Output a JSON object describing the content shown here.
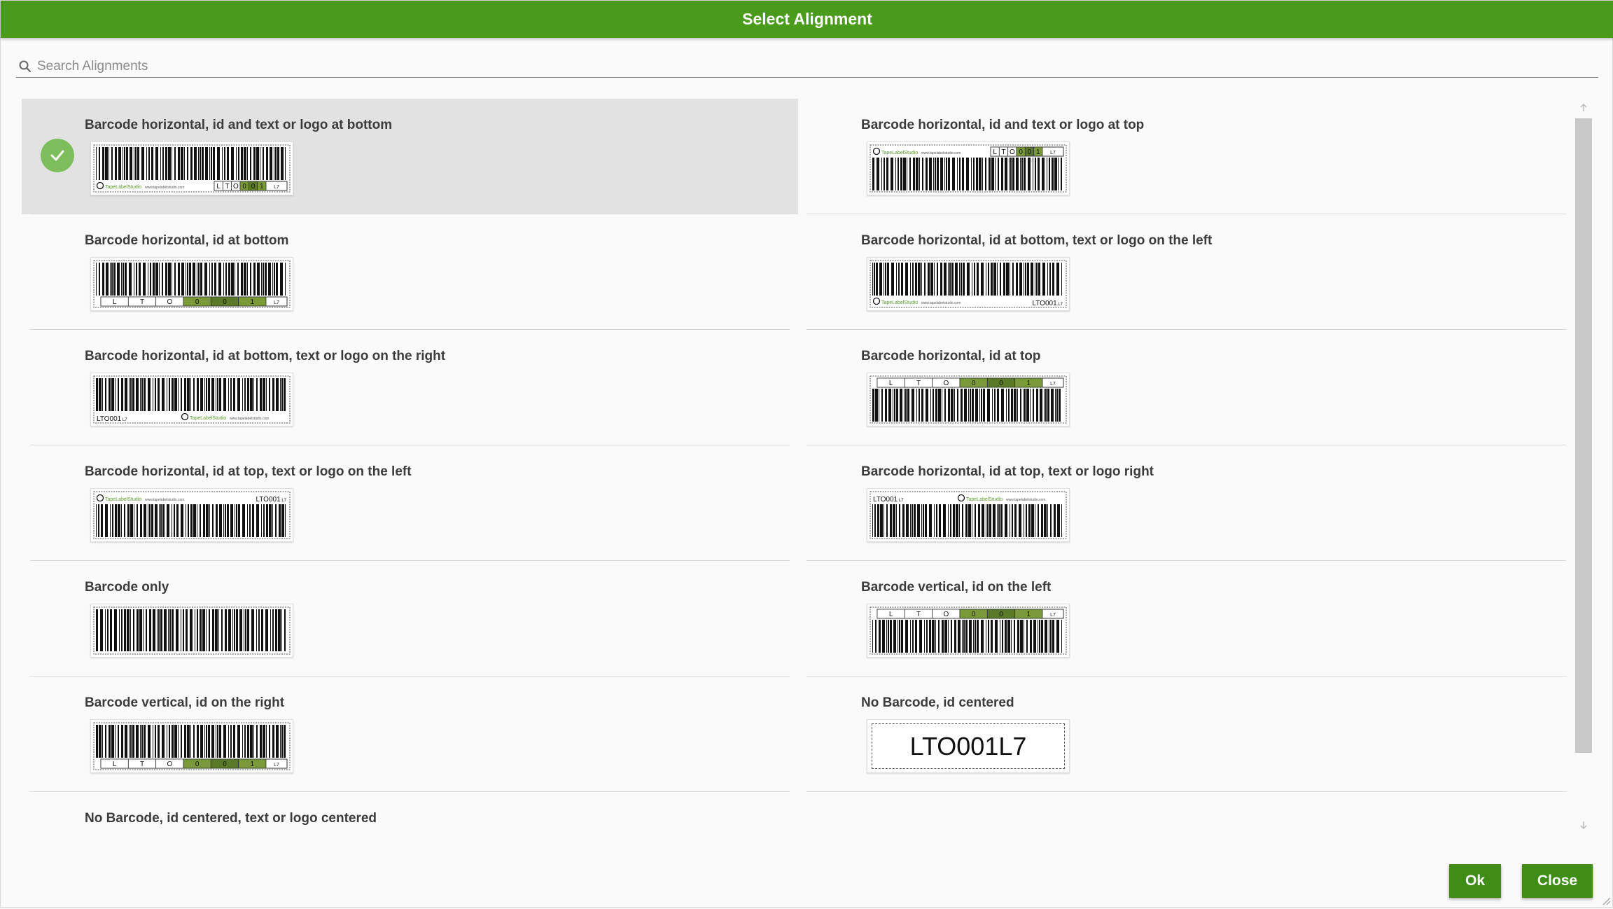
{
  "title": "Select Alignment",
  "search": {
    "placeholder": "Search Alignments",
    "icon": "search-icon"
  },
  "options": [
    {
      "label": "Barcode horizontal, id and text or logo at bottom",
      "selected": true
    },
    {
      "label": "Barcode horizontal, id and text or logo at top",
      "selected": false
    },
    {
      "label": "Barcode horizontal, id at bottom",
      "selected": false
    },
    {
      "label": "Barcode horizontal, id at bottom, text or logo on the left",
      "selected": false
    },
    {
      "label": "Barcode horizontal, id at bottom, text or logo on the right",
      "selected": false
    },
    {
      "label": "Barcode horizontal, id at top",
      "selected": false
    },
    {
      "label": "Barcode horizontal, id at top, text or logo on the left",
      "selected": false
    },
    {
      "label": "Barcode horizontal, id at top, text or logo right",
      "selected": false
    },
    {
      "label": "Barcode only",
      "selected": false
    },
    {
      "label": "Barcode vertical, id on the left",
      "selected": false
    },
    {
      "label": "Barcode vertical, id on the right",
      "selected": false
    },
    {
      "label": "No Barcode, id centered",
      "selected": false
    },
    {
      "label": "No Barcode, id centered, text or logo centered",
      "selected": false
    }
  ],
  "label_id": "LTO001",
  "label_suffix": "L7",
  "label_chars": [
    "L",
    "T",
    "O",
    "0",
    "0",
    "1"
  ],
  "brand_text": "TapeLabelStudio",
  "brand_url": "www.tapelabelstudio.com",
  "buttons": {
    "ok": "Ok",
    "close": "Close"
  },
  "colors": {
    "titlebar": "#4a9a1c",
    "button": "#3f8d17",
    "check": "#7dbd5c",
    "digit_cell": "#5a7a28",
    "digit_cell_alt": "#7a9a3a"
  }
}
